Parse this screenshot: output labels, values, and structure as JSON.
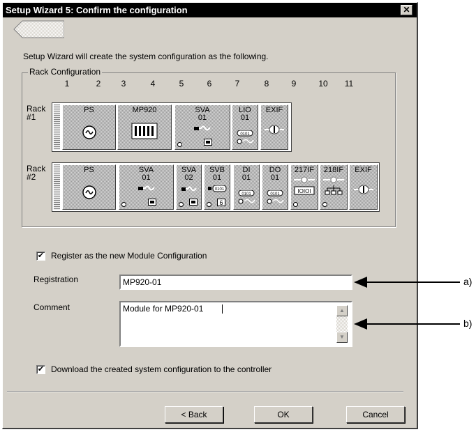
{
  "window": {
    "title": "Setup Wizard  5: Confirm the configuration",
    "close_symbol": "✕"
  },
  "intro_text": "Setup Wizard will create the system configuration as the following.",
  "rack_configuration": {
    "group_label": "Rack Configuration",
    "slot_numbers": [
      "1",
      "2",
      "3",
      "4",
      "5",
      "6",
      "7",
      "8",
      "9",
      "10",
      "11"
    ],
    "rack1": {
      "label": "Rack\n#1",
      "modules": [
        {
          "label": "PS",
          "icon": "power-icon"
        },
        {
          "label": "MP920",
          "icon": "cpu-icon"
        },
        {
          "label": "SVA\n01",
          "icon": "servo-icon"
        },
        {
          "label": "LIO\n01",
          "icon": "io-icon"
        },
        {
          "label": "EXIF",
          "icon": "exif-icon"
        }
      ]
    },
    "rack2": {
      "label": "Rack\n#2",
      "modules": [
        {
          "label": "PS",
          "icon": "power-icon"
        },
        {
          "label": "SVA\n01",
          "icon": "servo-icon"
        },
        {
          "label": "SVA\n02",
          "icon": "servo-icon"
        },
        {
          "label": "SVB\n01",
          "icon": "servo-bus-icon"
        },
        {
          "label": "DI\n01",
          "icon": "digital-in-icon"
        },
        {
          "label": "DO\n01",
          "icon": "digital-out-icon"
        },
        {
          "label": "217IF",
          "icon": "serial-icon"
        },
        {
          "label": "218IF",
          "icon": "ethernet-icon"
        },
        {
          "label": "EXIF",
          "icon": "exif-icon"
        }
      ]
    }
  },
  "register": {
    "checkbox_label": "Register as the new Module Configuration",
    "checked": true,
    "registration_label": "Registration",
    "registration_value": "MP920-01",
    "comment_label": "Comment",
    "comment_value": "Module for MP920-01"
  },
  "download": {
    "checkbox_label": "Download the created system configuration to the controller",
    "checked": true
  },
  "buttons": {
    "back": "< Back",
    "ok": "OK",
    "cancel": "Cancel"
  },
  "callouts": {
    "a": "a)",
    "b": "b)"
  },
  "check_mark": "✔"
}
